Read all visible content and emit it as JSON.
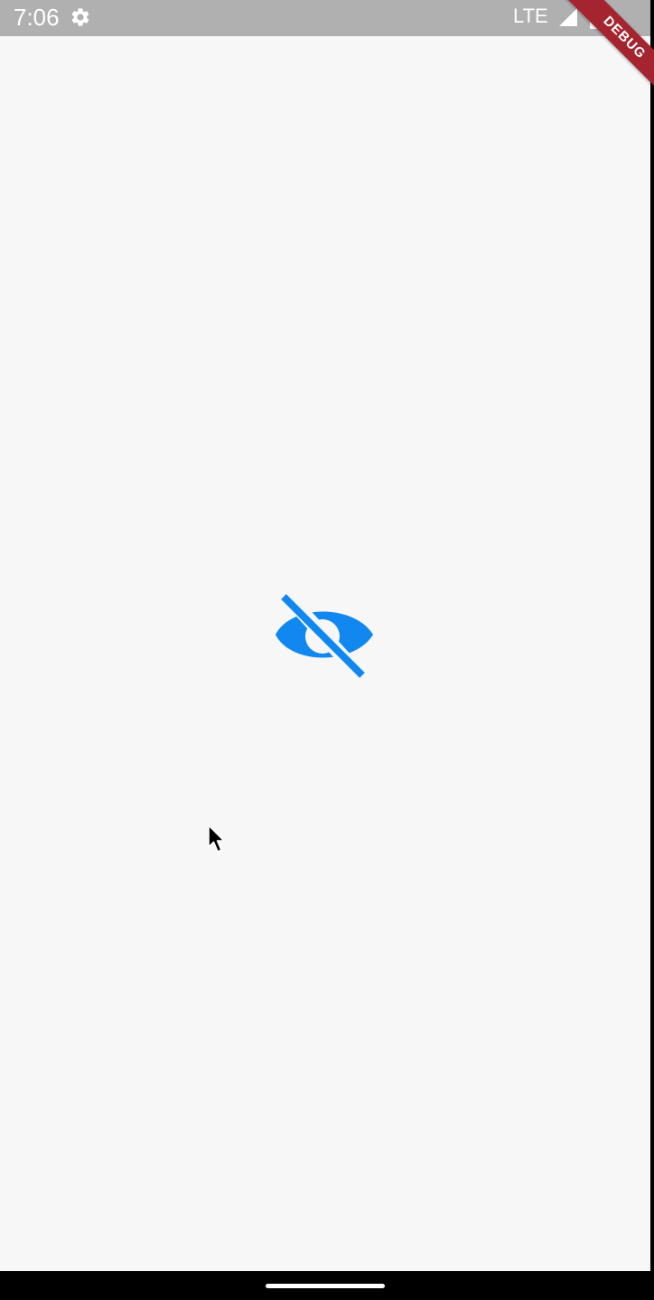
{
  "status_bar": {
    "time": "7:06",
    "network": "LTE",
    "icons": [
      "gear-icon",
      "signal-icon",
      "battery-icon"
    ],
    "background_color": "#b0b0b0"
  },
  "debug_banner": {
    "label": "DEBUG",
    "color": "#a4252f"
  },
  "main": {
    "toggle_icon": "visibility-off-icon",
    "icon_color": "#1188f0",
    "background_color": "#f7f7f7"
  },
  "overlay": {
    "cursor_icon": "mouse-pointer-icon"
  }
}
